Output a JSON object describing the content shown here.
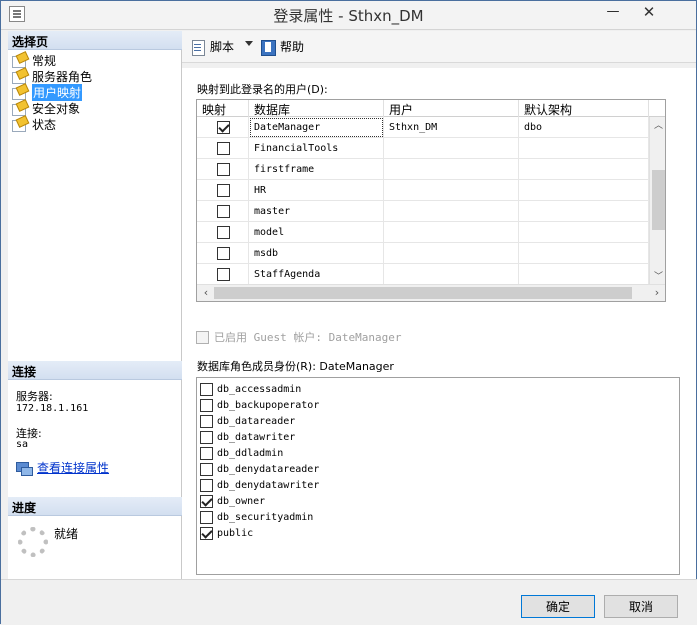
{
  "window": {
    "title": "登录属性 - Sthxn_DM",
    "minimize": "—",
    "close": "✕"
  },
  "left": {
    "pages_header": "选择页",
    "pages": [
      {
        "label": "常规"
      },
      {
        "label": "服务器角色"
      },
      {
        "label": "用户映射"
      },
      {
        "label": "安全对象"
      },
      {
        "label": "状态"
      }
    ],
    "selected_page": "用户映射",
    "connection_header": "连接",
    "server_label": "服务器:",
    "server_value": "172.18.1.161",
    "connection_label": "连接:",
    "connection_value": "sa",
    "view_connection_link": "查看连接属性",
    "progress_header": "进度",
    "progress_status": "就绪"
  },
  "toolbar": {
    "script_label": "脚本",
    "help_label": "帮助"
  },
  "mapping": {
    "label": "映射到此登录名的用户(D):",
    "columns": [
      "映射",
      "数据库",
      "用户",
      "默认架构"
    ],
    "rows": [
      {
        "mapped": true,
        "database": "DateManager",
        "user": "Sthxn_DM",
        "schema": "dbo"
      },
      {
        "mapped": false,
        "database": "FinancialTools",
        "user": "",
        "schema": ""
      },
      {
        "mapped": false,
        "database": "firstframe",
        "user": "",
        "schema": ""
      },
      {
        "mapped": false,
        "database": "HR",
        "user": "",
        "schema": ""
      },
      {
        "mapped": false,
        "database": "master",
        "user": "",
        "schema": ""
      },
      {
        "mapped": false,
        "database": "model",
        "user": "",
        "schema": ""
      },
      {
        "mapped": false,
        "database": "msdb",
        "user": "",
        "schema": ""
      },
      {
        "mapped": false,
        "database": "StaffAgenda",
        "user": "",
        "schema": ""
      }
    ]
  },
  "guest_label": "已启用 Guest 帐户: DateManager",
  "roles": {
    "label": "数据库角色成员身份(R): DateManager",
    "items": [
      {
        "name": "db_accessadmin",
        "checked": false
      },
      {
        "name": "db_backupoperator",
        "checked": false
      },
      {
        "name": "db_datareader",
        "checked": false
      },
      {
        "name": "db_datawriter",
        "checked": false
      },
      {
        "name": "db_ddladmin",
        "checked": false
      },
      {
        "name": "db_denydatareader",
        "checked": false
      },
      {
        "name": "db_denydatawriter",
        "checked": false
      },
      {
        "name": "db_owner",
        "checked": true
      },
      {
        "name": "db_securityadmin",
        "checked": false
      },
      {
        "name": "public",
        "checked": true
      }
    ]
  },
  "buttons": {
    "ok": "确定",
    "cancel": "取消"
  }
}
